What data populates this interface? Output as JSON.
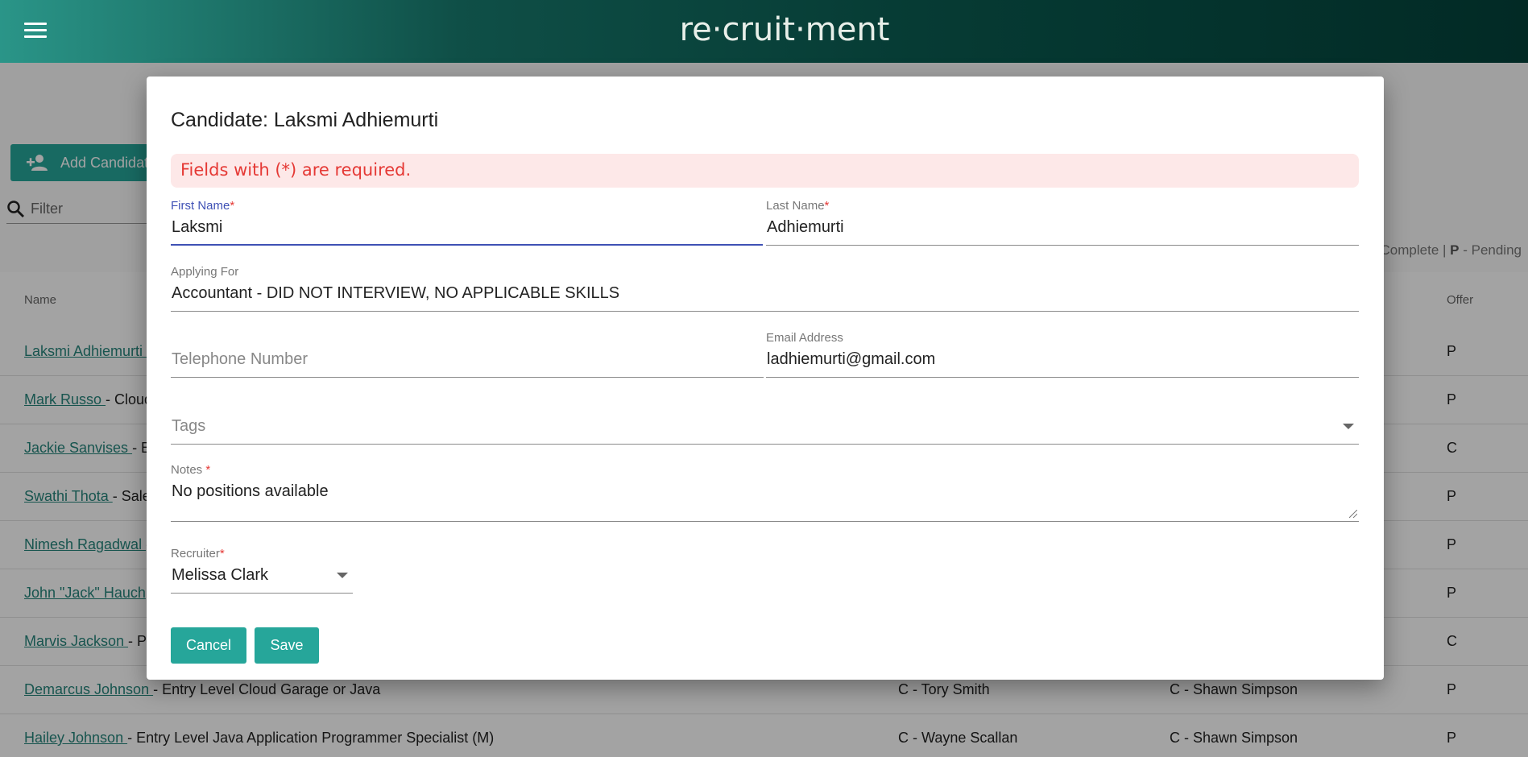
{
  "app": {
    "title": "re·cruit·ment"
  },
  "page": {
    "add_button": "Add Candidate",
    "filter_placeholder": "Filter",
    "legend": {
      "prefix": "Complete | ",
      "pending_key": "P",
      "pending_label": " - Pending"
    },
    "columns": {
      "name": "Name",
      "offer": "Offer"
    },
    "rows": [
      {
        "name": "Laksmi Adhiemurti ",
        "rest": "- ",
        "col1": "",
        "col2": "",
        "offer": "P"
      },
      {
        "name": "Mark Russo ",
        "rest": "- Cloud",
        "col1": "",
        "col2": "",
        "offer": "P"
      },
      {
        "name": "Jackie Sanvises ",
        "rest": "- E",
        "col1": "",
        "col2": "",
        "offer": "C"
      },
      {
        "name": "Swathi Thota ",
        "rest": "- Sale",
        "col1": "",
        "col2": "",
        "offer": "P"
      },
      {
        "name": "Nimesh Ragadwal ",
        "rest": "- ",
        "col1": "",
        "col2": "",
        "offer": "P"
      },
      {
        "name": "John \"Jack\" Hauch ",
        "rest": "",
        "col1": "",
        "col2": "",
        "offer": "P"
      },
      {
        "name": "Marvis Jackson ",
        "rest": "- Pr",
        "col1": "",
        "col2": "",
        "offer": "C"
      },
      {
        "name": "Demarcus Johnson ",
        "rest": "- Entry Level Cloud Garage or Java",
        "col1": "C - Tory Smith",
        "col2": "C - Shawn Simpson",
        "offer": "P"
      },
      {
        "name": "Hailey Johnson ",
        "rest": "- Entry Level Java Application Programmer Specialist (M)",
        "col1": "C - Wayne Scallan",
        "col2": "C - Shawn Simpson",
        "offer": "P"
      }
    ]
  },
  "dialog": {
    "title": "Candidate: Laksmi Adhiemurti",
    "alert": "Fields with (*) are required.",
    "required_mark": "*",
    "first_name": {
      "label": "First Name",
      "value": "Laksmi"
    },
    "last_name": {
      "label": "Last Name",
      "value": "Adhiemurti"
    },
    "applying_for": {
      "label": "Applying For",
      "value": "Accountant - DID NOT INTERVIEW, NO APPLICABLE SKILLS"
    },
    "telephone": {
      "placeholder": "Telephone Number"
    },
    "email": {
      "label": "Email Address",
      "value": "ladhiemurti@gmail.com"
    },
    "tags": {
      "placeholder": "Tags"
    },
    "notes": {
      "label": "Notes ",
      "value": "No positions available"
    },
    "recruiter": {
      "label": "Recruiter",
      "value": "Melissa Clark"
    },
    "cancel_label": "Cancel",
    "save_label": "Save"
  }
}
